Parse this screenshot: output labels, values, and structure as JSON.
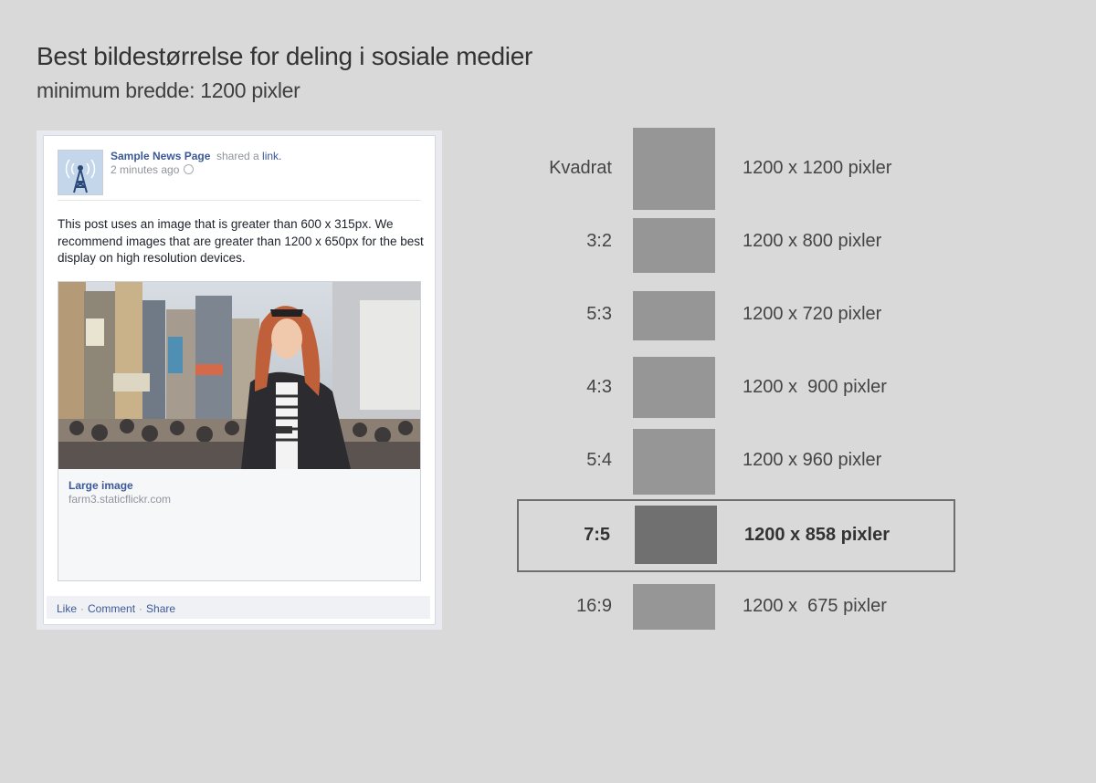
{
  "header": {
    "title": "Best bildestørrelse for deling i sosiale medier",
    "subtitle": "minimum bredde: 1200 pixler"
  },
  "post": {
    "page_name": "Sample News Page",
    "shared": "shared a",
    "link": "link.",
    "time": "2 minutes ago",
    "text": "This post uses an image that is greater than 600 x 315px. We recommend images that are greater than 1200 x 650px for the best display on high resolution devices.",
    "attachment_title": "Large image",
    "attachment_domain": "farm3.staticflickr.com",
    "actions": [
      "Like",
      "Comment",
      "Share"
    ],
    "separator": "·"
  },
  "ratios": [
    {
      "ratio": "Kvadrat",
      "size": "1200 x 1200 pixler",
      "highlighted": false
    },
    {
      "ratio": "3:2",
      "size": "1200 x 800 pixler",
      "highlighted": false
    },
    {
      "ratio": "5:3",
      "size": "1200 x 720 pixler",
      "highlighted": false
    },
    {
      "ratio": "4:3",
      "size": "1200 x  900 pixler",
      "highlighted": false
    },
    {
      "ratio": "5:4",
      "size": "1200 x 960 pixler",
      "highlighted": false
    },
    {
      "ratio": "7:5",
      "size": "1200 x 858 pixler",
      "highlighted": true
    },
    {
      "ratio": "16:9",
      "size": "1200 x  675 pixler",
      "highlighted": false
    }
  ],
  "colors": {
    "background": "#d9d9d9",
    "box": "#969696",
    "box_highlight": "#707070",
    "facebook_link": "#3b5998"
  }
}
